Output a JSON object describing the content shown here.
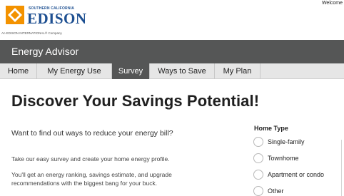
{
  "header": {
    "logo_top": "SOUTHERN CALIFORNIA",
    "logo_main": "EDISON",
    "logo_sub": "An EDISON INTERNATIONAL® Company",
    "welcome": "Welcome"
  },
  "titlebar": {
    "title": "Energy Advisor"
  },
  "tabs": [
    {
      "label": "Home"
    },
    {
      "label": "My Energy Use"
    },
    {
      "label": "Survey",
      "active": true
    },
    {
      "label": "Ways to Save"
    },
    {
      "label": "My Plan"
    }
  ],
  "main": {
    "heading": "Discover Your Savings Potential!",
    "question": "Want to find out ways to reduce your energy bill?",
    "para1": "Take our easy survey and create your home energy profile.",
    "para2": "You'll get an energy ranking, savings estimate, and upgrade recommendations with the biggest bang for your buck."
  },
  "home_type": {
    "label": "Home Type",
    "options": [
      {
        "label": "Single-family"
      },
      {
        "label": "Townhome"
      },
      {
        "label": "Apartment or condo"
      },
      {
        "label": "Other"
      }
    ]
  },
  "colors": {
    "brand_blue": "#1d4f91",
    "brand_orange": "#f39200",
    "nav_dark": "#555656"
  }
}
